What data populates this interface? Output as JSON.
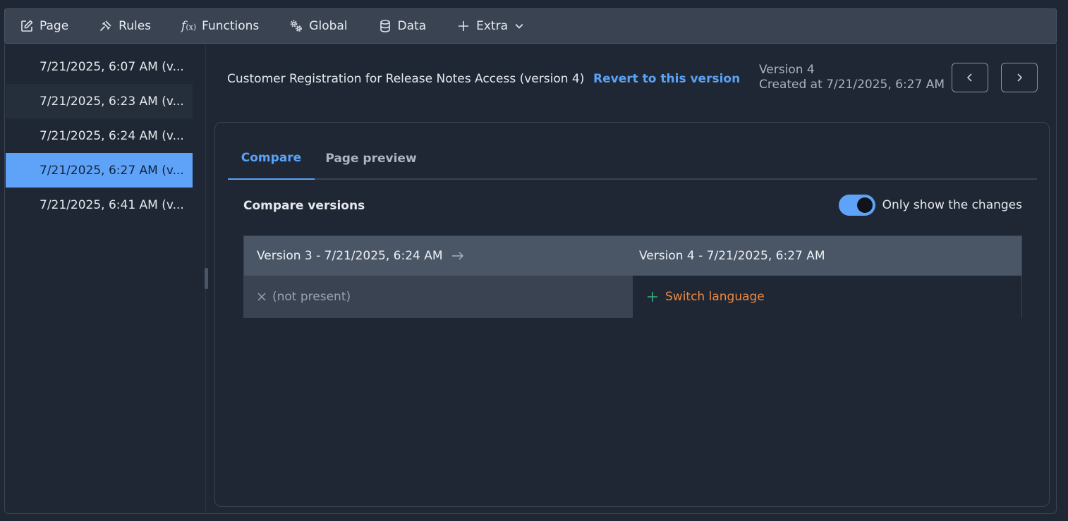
{
  "toolbar": {
    "items": [
      {
        "label": "Page",
        "icon": "edit-icon"
      },
      {
        "label": "Rules",
        "icon": "gavel-icon"
      },
      {
        "label": "Functions",
        "icon": "function-icon"
      },
      {
        "label": "Global",
        "icon": "gears-icon"
      },
      {
        "label": "Data",
        "icon": "database-icon"
      },
      {
        "label": "Extra",
        "icon": "plus-icon"
      }
    ]
  },
  "sidebar": {
    "versions": [
      "7/21/2025, 6:07 AM (v...",
      "7/21/2025, 6:23 AM (v...",
      "7/21/2025, 6:24 AM (v...",
      "7/21/2025, 6:27 AM (v...",
      "7/21/2025, 6:41 AM (v..."
    ],
    "active_index": 3
  },
  "header": {
    "title": "Customer Registration for Release Notes Access (version 4)",
    "revert_label": "Revert to this version",
    "version_label": "Version 4",
    "created_label": "Created at 7/21/2025, 6:27 AM"
  },
  "tabs": {
    "compare": "Compare",
    "preview": "Page preview"
  },
  "compare": {
    "title": "Compare versions",
    "toggle_label": "Only show the changes",
    "toggle_on": true,
    "left_header": "Version 3 - 7/21/2025, 6:24 AM",
    "right_header": "Version 4 - 7/21/2025, 6:27 AM",
    "left_value": "(not present)",
    "right_value": "Switch language"
  },
  "colors": {
    "accent": "#5ea3f8",
    "added": "#f0883e",
    "plus": "#36b37e"
  }
}
